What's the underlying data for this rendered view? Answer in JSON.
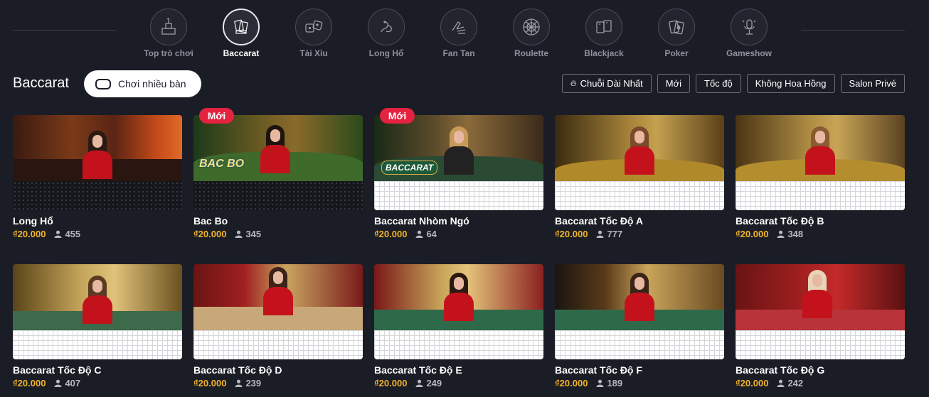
{
  "nav": {
    "categories": [
      {
        "label": "Top trò chơi",
        "icon": "trophy-icon",
        "active": false
      },
      {
        "label": "Baccarat",
        "icon": "baccarat-cards-icon",
        "active": true
      },
      {
        "label": "Tài Xỉu",
        "icon": "dice-icon",
        "active": false
      },
      {
        "label": "Long Hổ",
        "icon": "dragon-icon",
        "active": false
      },
      {
        "label": "Fan Tan",
        "icon": "fan-hand-icon",
        "active": false
      },
      {
        "label": "Roulette",
        "icon": "roulette-wheel-icon",
        "active": false
      },
      {
        "label": "Blackjack",
        "icon": "playing-cards-icon",
        "active": false
      },
      {
        "label": "Poker",
        "icon": "poker-cards-icon",
        "active": false
      },
      {
        "label": "Gameshow",
        "icon": "microphone-icon",
        "active": false
      }
    ]
  },
  "header": {
    "title": "Baccarat",
    "multi_table_label": "Chơi nhiều bàn",
    "filters": [
      {
        "label": "Chuỗi Dài Nhất",
        "icon": "flame-icon"
      },
      {
        "label": "Mới"
      },
      {
        "label": "Tốc độ"
      },
      {
        "label": "Không Hoa Hồng"
      },
      {
        "label": "Salon Privé"
      }
    ]
  },
  "new_badge_label": "Mới",
  "tables": [
    {
      "name": "Long Hổ",
      "price": "₫20.000",
      "players": "455"
    },
    {
      "name": "Bac Bo",
      "price": "₫20.000",
      "players": "345",
      "is_new": true,
      "logo": "BAC BO"
    },
    {
      "name": "Baccarat Nhòm Ngó",
      "price": "₫20.000",
      "players": "64",
      "is_new": true,
      "logo": "BACCARAT"
    },
    {
      "name": "Baccarat Tốc Độ A",
      "price": "₫20.000",
      "players": "777"
    },
    {
      "name": "Baccarat Tốc Độ B",
      "price": "₫20.000",
      "players": "348"
    },
    {
      "name": "Baccarat Tốc Độ C",
      "price": "₫20.000",
      "players": "407"
    },
    {
      "name": "Baccarat Tốc Độ D",
      "price": "₫20.000",
      "players": "239"
    },
    {
      "name": "Baccarat Tốc Độ E",
      "price": "₫20.000",
      "players": "249"
    },
    {
      "name": "Baccarat Tốc Độ F",
      "price": "₫20.000",
      "players": "189"
    },
    {
      "name": "Baccarat Tốc Độ G",
      "price": "₫20.000",
      "players": "242"
    }
  ],
  "colors": {
    "background": "#1b1d26",
    "price": "#f0b429",
    "new_badge": "#e3223f",
    "banker_red": "#d42a2a",
    "player_blue": "#1f5fd1"
  }
}
